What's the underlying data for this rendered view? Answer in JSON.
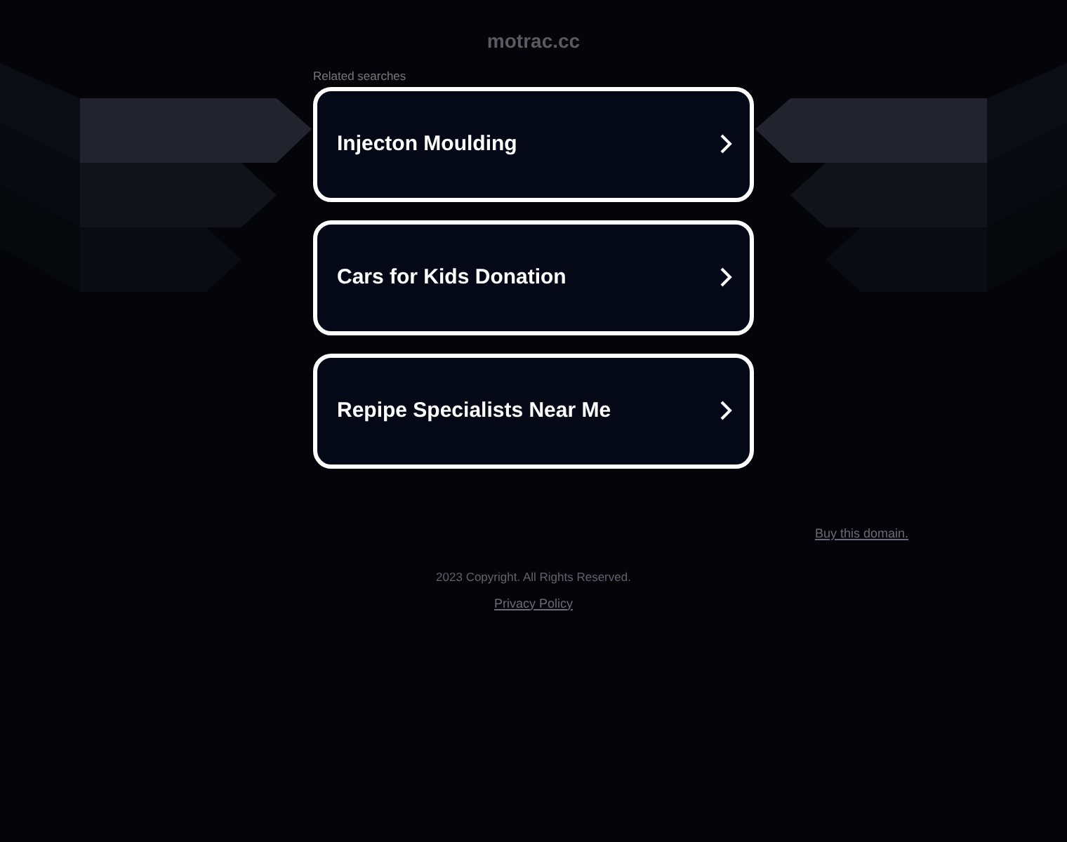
{
  "site_title": "motrac.cc",
  "related_label": "Related searches",
  "searches": [
    {
      "label": "Injecton Moulding"
    },
    {
      "label": "Cars for Kids Donation"
    },
    {
      "label": "Repipe Specialists Near Me"
    }
  ],
  "buy_link": "Buy this domain.",
  "copyright": "2023 Copyright. All Rights Reserved.",
  "privacy_link": "Privacy Policy"
}
